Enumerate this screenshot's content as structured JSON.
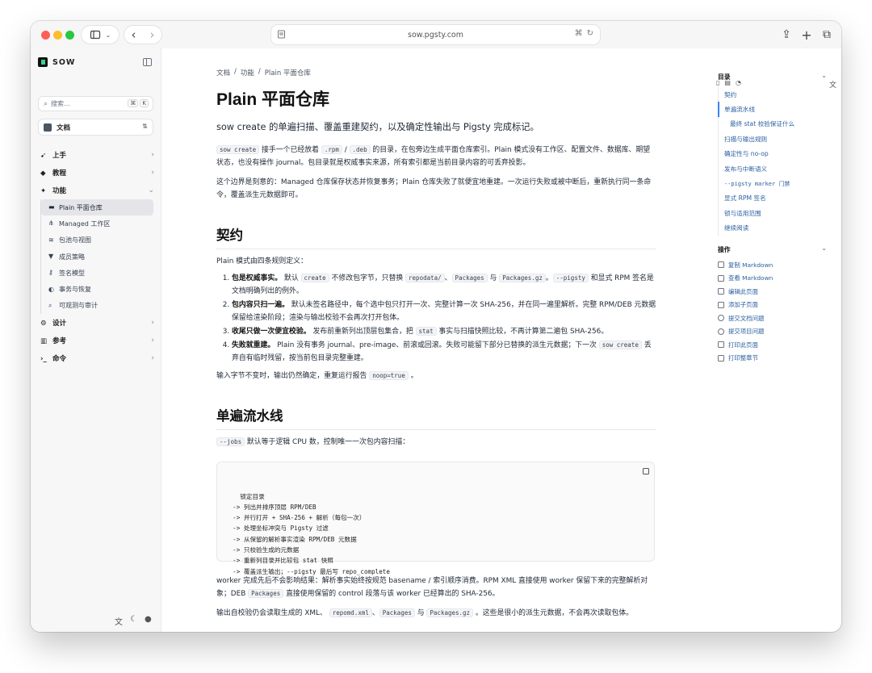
{
  "browser": {
    "url": "sow.pgsty.com"
  },
  "sidebar": {
    "brand": "SOW",
    "search_placeholder": "搜索...",
    "search_keys": [
      "⌘",
      "K"
    ],
    "doc_selector": "文档",
    "nav": [
      {
        "label": "上手",
        "icon": "rocket-icon"
      },
      {
        "label": "教程",
        "icon": "graduation-cap-icon"
      },
      {
        "label": "功能",
        "icon": "puzzle-icon",
        "expanded": true
      }
    ],
    "sub_items": [
      {
        "label": "Plain 平面仓库",
        "icon": "folder-icon",
        "active": true
      },
      {
        "label": "Managed 工作区",
        "icon": "network-icon"
      },
      {
        "label": "包池与视图",
        "icon": "layers-icon"
      },
      {
        "label": "成员策略",
        "icon": "filter-icon"
      },
      {
        "label": "签名模型",
        "icon": "key-icon"
      },
      {
        "label": "事务与恢复",
        "icon": "shield-icon"
      },
      {
        "label": "可观测与审计",
        "icon": "magnifier-icon"
      }
    ],
    "nav_after": [
      {
        "label": "设计",
        "icon": "settings-icon"
      },
      {
        "label": "参考",
        "icon": "book-icon"
      },
      {
        "label": "命令",
        "icon": "terminal-icon"
      }
    ]
  },
  "main": {
    "breadcrumb": [
      "文档",
      "功能",
      "Plain 平面仓库"
    ],
    "title": "Plain 平面仓库",
    "subtitle": "sow create 的单遍扫描、覆盖重建契约，以及确定性输出与 Pigsty 完成标记。",
    "intro_p1": {
      "code1": "sow create",
      "t1": "接手一个已经放着",
      "code2": ".rpm",
      "sep": "/",
      "code3": ".deb",
      "t2": "的目录，在包旁边生成平面仓库索引。Plain 模式没有工作区、配置文件、数据库、期望状态，也没有操作 journal。包目录就是权威事实来源，所有索引都是当前目录内容的可丢弃投影。"
    },
    "intro_p2": "这个边界是刻意的：Managed 仓库保存状态并恢复事务；Plain 仓库失败了就便宜地重建。一次运行失败或被中断后，重新执行同一条命令，覆盖派生元数据即可。",
    "contract": {
      "heading": "契约",
      "lead": "Plain 模式由四条规则定义：",
      "r1_bold": "包是权威事实。",
      "r1_t1": "默认",
      "r1_c1": "create",
      "r1_t2": "不修改包字节，只替换",
      "r1_c2": "repodata/",
      "r1_t3": "、",
      "r1_c3": "Packages",
      "r1_t4": "与",
      "r1_c4": "Packages.gz",
      "r1_t5": "。",
      "r1_c5": "--pigsty",
      "r1_t6": "和显式 RPM 签名是文档明确列出的例外。",
      "r2_bold": "包内容只扫一遍。",
      "r2_text": "默认未签名路径中，每个选中包只打开一次、完整计算一次 SHA-256，并在同一遍里解析。完整 RPM/DEB 元数据保留给渲染阶段；渲染与输出校验不会再次打开包体。",
      "r3_bold": "收尾只做一次便宜校验。",
      "r3_t1": "发布前重新列出顶层包集合，把",
      "r3_c1": "stat",
      "r3_t2": "事实与扫描快照比较，不再计算第二遍包 SHA-256。",
      "r4_bold": "失败就重建。",
      "r4_t1": "Plain 没有事务 journal、pre-image、前滚或回滚。失败可能留下部分已替换的派生元数据；下一次",
      "r4_c1": "sow create",
      "r4_t2": "丢弃自有临时残留，按当前包目录完整重建。",
      "tail_t1": "输入字节不变时，输出仍然确定，重复运行报告",
      "tail_c1": "noop=true",
      "tail_t2": "。"
    },
    "pipeline": {
      "heading": "单遍流水线",
      "lead_code": "--jobs",
      "lead_text": "默认等于逻辑 CPU 数，控制唯一一次包内容扫描：",
      "code": "锁定目录\n  -> 列出并排序顶层 RPM/DEB\n  -> 并行打开 + SHA-256 + 解析（每包一次）\n  -> 处理坐标冲突与 Pigsty 过滤\n  -> 从保留的解析事实渲染 RPM/DEB 元数据\n  -> 只校验生成的元数据\n  -> 重新列目录并比较包 stat 快照\n  -> 覆盖派生输出；--pigsty 最后写 repo_complete",
      "after1": "worker 完成先后不会影响结果：解析事实始终按规范 basename / 索引顺序消费。RPM XML 直接使用 worker 保留下来的完整解析对象；DEB",
      "after1_code": "Packages",
      "after1_t2": "直接使用保留的 control 段落与该 worker 已经算出的 SHA-256。",
      "after2_t1": "输出自校验仍会读取生成的 XML、",
      "after2_c1": "repomd.xml",
      "after2_t2": "、",
      "after2_c2": "Packages",
      "after2_t3": "与",
      "after2_c3": "Packages.gz",
      "after2_t4": "。这些是很小的派生元数据，不会再次读取包体。"
    }
  },
  "toc": {
    "heading": "目录",
    "items": [
      {
        "label": "契约",
        "level": 1
      },
      {
        "label": "单遍流水线",
        "level": 1,
        "active": true
      },
      {
        "label": "最终 stat 校验保证什么",
        "level": 2
      },
      {
        "label": "扫描与输出规则",
        "level": 1
      },
      {
        "label": "确定性与 no-op",
        "level": 1
      },
      {
        "label": "发布与中断语义",
        "level": 1
      },
      {
        "label": "--pigsty marker 门禁",
        "level": 1,
        "mono": true
      },
      {
        "label": "显式 RPM 签名",
        "level": 1
      },
      {
        "label": "锁与适用范围",
        "level": 1
      },
      {
        "label": "继续阅读",
        "level": 1
      }
    ]
  },
  "ops": {
    "heading": "操作",
    "items": [
      "复制 Markdown",
      "查看 Markdown",
      "编辑此页面",
      "添加子页面",
      "提交文档问题",
      "提交项目问题",
      "打印此页面",
      "打印整章节"
    ]
  }
}
